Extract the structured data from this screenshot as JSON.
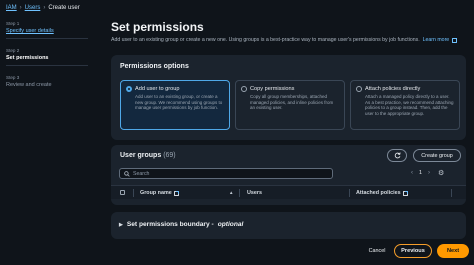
{
  "breadcrumb": {
    "items": [
      {
        "label": "IAM"
      },
      {
        "label": "Users"
      },
      {
        "label": "Create user"
      }
    ]
  },
  "steps": [
    {
      "num": "Step 1",
      "label": "Specify user details",
      "state": "done"
    },
    {
      "num": "Step 2",
      "label": "Set permissions",
      "state": "current"
    },
    {
      "num": "Step 3",
      "label": "Review and create",
      "state": "pending"
    }
  ],
  "page": {
    "title": "Set permissions",
    "subtitle": "Add user to an existing group or create a new one. Using groups is a best-practice way to manage user's permissions by job functions.",
    "learn_more": "Learn more"
  },
  "permission_options": {
    "title": "Permissions options",
    "selected": "add_to_group",
    "options": [
      {
        "id": "add_to_group",
        "label": "Add user to group",
        "desc": "Add user to an existing group, or create a new group. We recommend using groups to manage user permissions by job function."
      },
      {
        "id": "copy_permissions",
        "label": "Copy permissions",
        "desc": "Copy all group memberships, attached managed policies, and inline policies from an existing user."
      },
      {
        "id": "attach_policies",
        "label": "Attach policies directly",
        "desc": "Attach a managed policy directly to a user. As a best practice, we recommend attaching policies to a group instead. Then, add the user to the appropriate group."
      }
    ]
  },
  "user_groups": {
    "title": "User groups",
    "count": "(69)",
    "create_label": "Create group",
    "search_placeholder": "Search",
    "page": "1",
    "columns": [
      "Group name",
      "Users",
      "Attached policies"
    ]
  },
  "boundary": {
    "title": "Set permissions boundary -",
    "optional": "optional"
  },
  "footer": {
    "cancel": "Cancel",
    "previous": "Previous",
    "next": "Next"
  },
  "colors": {
    "accent": "#ff9900",
    "link": "#6fc2ff",
    "selected_border": "#4fa8e8",
    "background": "#0f141a",
    "panel": "#1b232d"
  },
  "icons": [
    "chevron-right-icon",
    "external-link-icon",
    "refresh-icon",
    "search-icon",
    "chevron-left-icon",
    "gear-icon",
    "sort-down-icon",
    "caret-right-icon"
  ]
}
